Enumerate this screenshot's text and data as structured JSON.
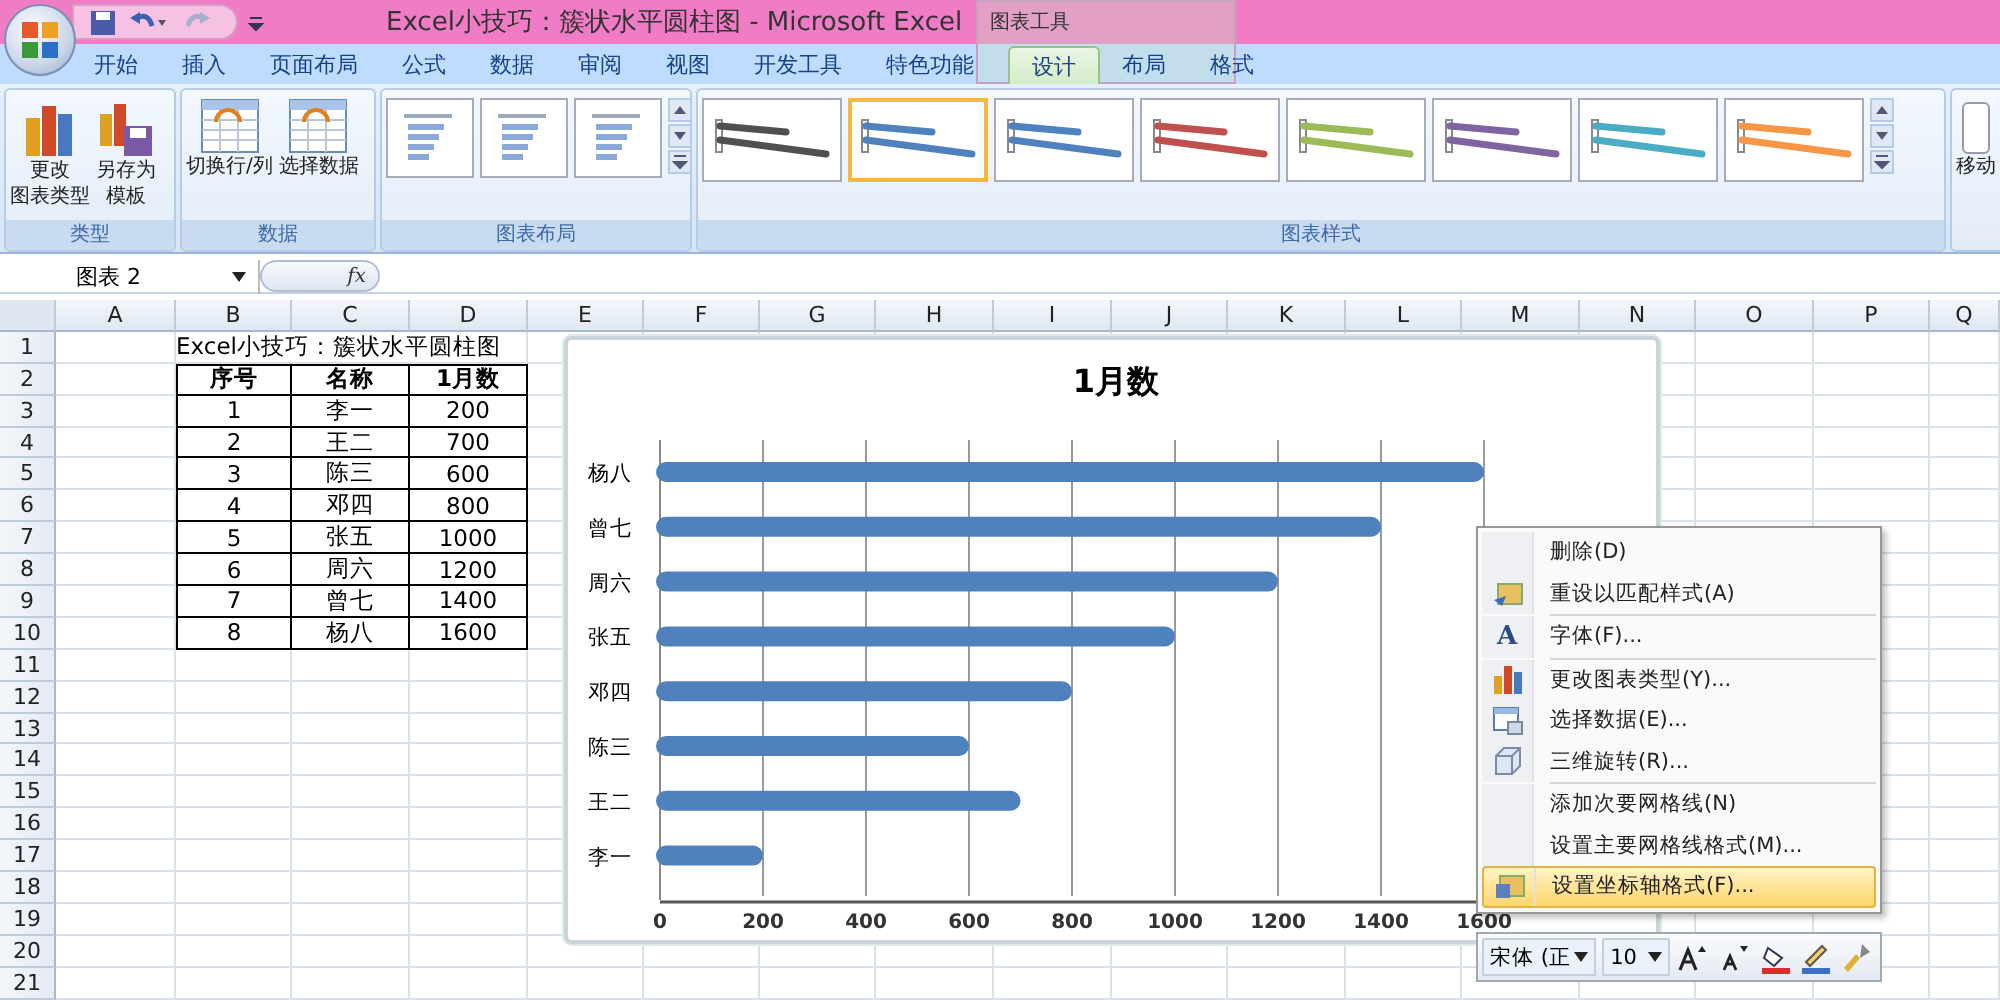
{
  "title_bar": {
    "title": "Excel小技巧：簇状水平圆柱图 - Microsoft Excel",
    "context_group": "图表工具"
  },
  "ribbon_tabs": [
    {
      "label": "开始",
      "selected": false
    },
    {
      "label": "插入",
      "selected": false
    },
    {
      "label": "页面布局",
      "selected": false
    },
    {
      "label": "公式",
      "selected": false
    },
    {
      "label": "数据",
      "selected": false
    },
    {
      "label": "审阅",
      "selected": false
    },
    {
      "label": "视图",
      "selected": false
    },
    {
      "label": "开发工具",
      "selected": false
    },
    {
      "label": "特色功能",
      "selected": false
    },
    {
      "label": "设计",
      "selected": true,
      "kind": "context"
    },
    {
      "label": "布局",
      "selected": false,
      "kind": "context"
    },
    {
      "label": "格式",
      "selected": false,
      "kind": "context"
    }
  ],
  "ribbon_groups": [
    {
      "label": "类型",
      "buttons": [
        {
          "lines": [
            "更改",
            "图表类型"
          ]
        },
        {
          "lines": [
            "另存为",
            "模板"
          ]
        }
      ]
    },
    {
      "label": "数据",
      "buttons": [
        {
          "lines": [
            "切换行/列"
          ]
        },
        {
          "lines": [
            "选择数据"
          ]
        }
      ]
    },
    {
      "label": "图表布局",
      "kind": "layouts"
    },
    {
      "label": "图表样式",
      "kind": "styles",
      "styles": [
        {
          "color": "#505050",
          "selected": false
        },
        {
          "color": "#4f81bd",
          "selected": true
        },
        {
          "color": "#4f81bd",
          "selected": false
        },
        {
          "color": "#c0504d",
          "selected": false
        },
        {
          "color": "#9bbb59",
          "selected": false
        },
        {
          "color": "#8064a2",
          "selected": false
        },
        {
          "color": "#4bacc6",
          "selected": false
        },
        {
          "color": "#f79646",
          "selected": false
        }
      ]
    },
    {
      "kind": "partial",
      "buttons": [
        {
          "lines": [
            "移动"
          ]
        }
      ]
    }
  ],
  "name_box": "图表 2",
  "formula_label": "fx",
  "columns": [
    "A",
    "B",
    "C",
    "D",
    "E",
    "F",
    "G",
    "H",
    "I",
    "J",
    "K",
    "L",
    "M",
    "N",
    "O",
    "P",
    "Q"
  ],
  "rows": [
    "1",
    "2",
    "3",
    "4",
    "5",
    "6",
    "7",
    "8",
    "9",
    "10",
    "11",
    "12",
    "13",
    "14",
    "15",
    "16",
    "17",
    "18",
    "19",
    "20",
    "21"
  ],
  "sheet": {
    "title": "Excel小技巧：簇状水平圆柱图",
    "header": [
      "序号",
      "名称",
      "1月数"
    ],
    "data": [
      [
        "1",
        "李一",
        "200"
      ],
      [
        "2",
        "王二",
        "700"
      ],
      [
        "3",
        "陈三",
        "600"
      ],
      [
        "4",
        "邓四",
        "800"
      ],
      [
        "5",
        "张五",
        "1000"
      ],
      [
        "6",
        "周六",
        "1200"
      ],
      [
        "7",
        "曾七",
        "1400"
      ],
      [
        "8",
        "杨八",
        "1600"
      ]
    ]
  },
  "chart": {
    "chart_data": {
      "type": "bar",
      "orientation": "horizontal",
      "title": "1月数",
      "categories": [
        "杨八",
        "曾七",
        "周六",
        "张五",
        "邓四",
        "陈三",
        "王二",
        "李一"
      ],
      "series": [
        {
          "color": "#4f81bd",
          "values": [
            1600,
            1400,
            1200,
            1000,
            800,
            600,
            700,
            200
          ]
        }
      ],
      "xlim": [
        0,
        1600
      ],
      "xticks": [
        0,
        200,
        400,
        600,
        800,
        1000,
        1200,
        1400,
        1600
      ],
      "grid": true
    }
  },
  "context_menu": [
    {
      "label": "删除(D)",
      "separator_before": false,
      "highlighted": false
    },
    {
      "label": "重设以匹配样式(A)",
      "separator_before": false,
      "highlighted": false
    },
    {
      "label": "字体(F)...",
      "icon_glyph": "A",
      "separator_before": true,
      "highlighted": false
    },
    {
      "label": "更改图表类型(Y)...",
      "separator_before": true,
      "highlighted": false
    },
    {
      "label": "选择数据(E)...",
      "separator_before": false,
      "highlighted": false
    },
    {
      "label": "三维旋转(R)...",
      "separator_before": false,
      "highlighted": false
    },
    {
      "label": "添加次要网格线(N)",
      "separator_before": true,
      "highlighted": false
    },
    {
      "label": "设置主要网格线格式(M)...",
      "separator_before": false,
      "highlighted": false
    },
    {
      "label": "设置坐标轴格式(F)...",
      "separator_before": false,
      "highlighted": true
    }
  ],
  "mini_toolbar": {
    "font": "宋体 (正",
    "size": "10"
  }
}
